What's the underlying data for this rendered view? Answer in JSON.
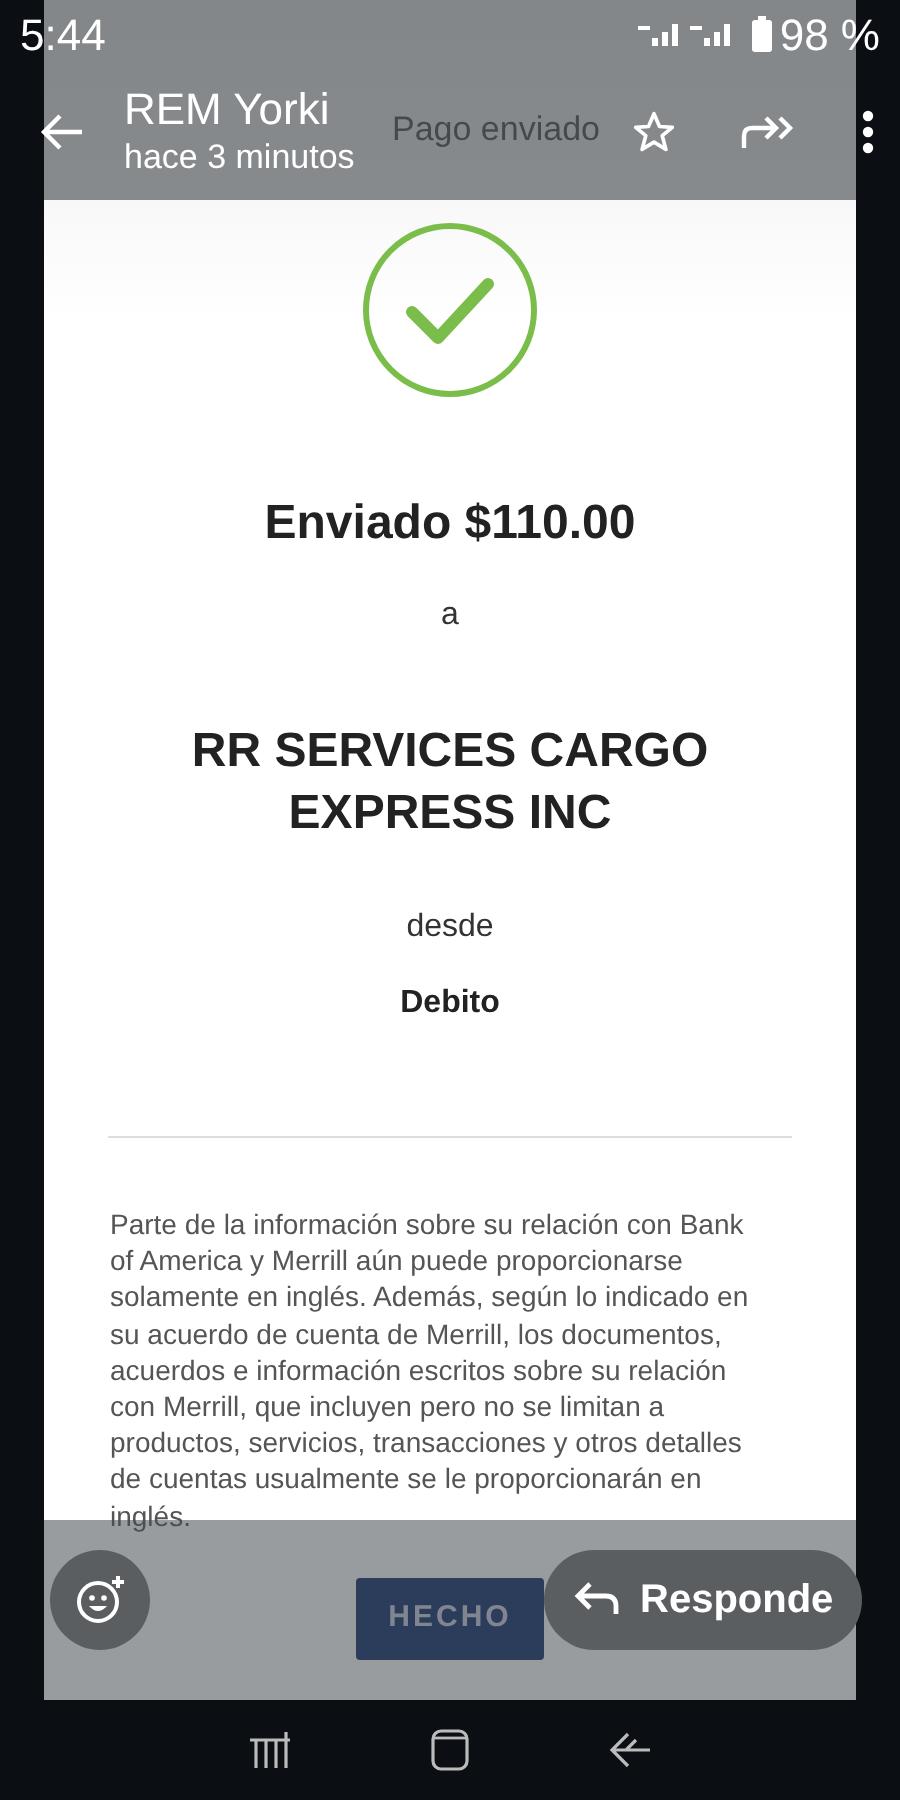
{
  "status_bar": {
    "time": "5:44",
    "battery": "98 %"
  },
  "header": {
    "title": "REM Yorki",
    "subtitle": "hace 3 minutos"
  },
  "image": {
    "title": "Pago enviado",
    "amount": "Enviado $110.00",
    "to_label": "a",
    "recipient": "RR SERVICES CARGO EXPRESS INC",
    "from_label": "desde",
    "account": "Debito",
    "disclaimer": "Parte de la información sobre su relación con Bank of America y Merrill aún puede proporcionarse solamente en inglés. Además, según lo indicado en su acuerdo de cuenta de Merrill, los documentos, acuerdos e información escritos sobre su relación con Merrill, que incluyen pero no se limitan a productos, servicios, transacciones y otros detalles de cuentas usualmente se le proporcionarán en inglés.",
    "button": "HECHO"
  },
  "reply_button": "Responde"
}
